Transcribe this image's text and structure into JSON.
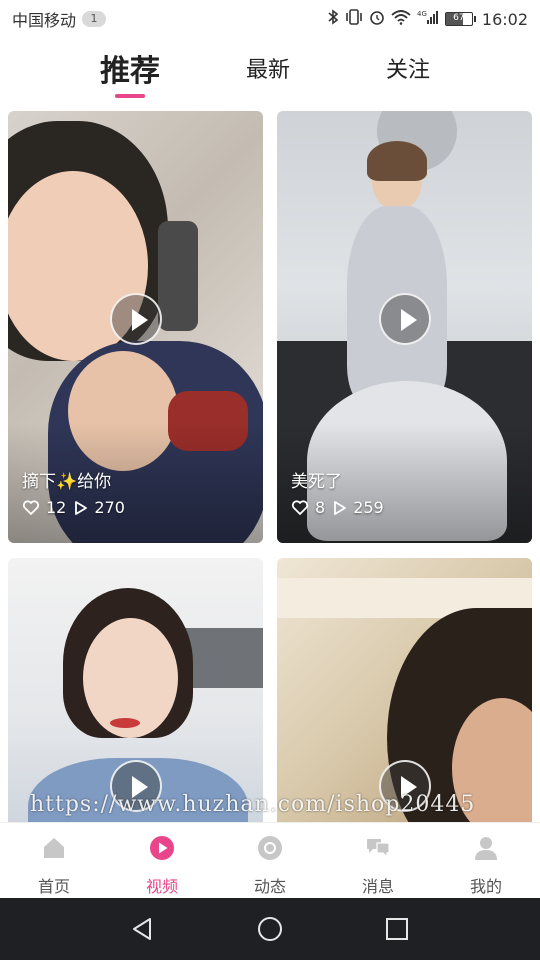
{
  "status_bar": {
    "carrier": "中国移动",
    "sim_badge": "1",
    "network": "4G",
    "battery": "67",
    "battery_level": 0.67,
    "time": "16:02"
  },
  "top_tabs": [
    {
      "label": "推荐",
      "active": true
    },
    {
      "label": "最新",
      "active": false
    },
    {
      "label": "关注",
      "active": false
    }
  ],
  "videos": [
    {
      "title": "摘下✨给你",
      "likes": "12",
      "plays": "270"
    },
    {
      "title": "美死了",
      "likes": "8",
      "plays": "259"
    },
    {
      "title": "",
      "likes": "",
      "plays": ""
    },
    {
      "title": "",
      "likes": "",
      "plays": ""
    }
  ],
  "watermark": "https://www.huzhan.com/ishop20445",
  "bottom_nav": [
    {
      "label": "首页",
      "icon": "home-icon",
      "active": false
    },
    {
      "label": "视频",
      "icon": "video-icon",
      "active": true
    },
    {
      "label": "动态",
      "icon": "moments-icon",
      "active": false
    },
    {
      "label": "消息",
      "icon": "message-icon",
      "active": false
    },
    {
      "label": "我的",
      "icon": "profile-icon",
      "active": false
    }
  ],
  "colors": {
    "accent": "#e8458b",
    "nav_inactive": "#c7c7c7",
    "system_nav_bg": "#1f2024"
  }
}
